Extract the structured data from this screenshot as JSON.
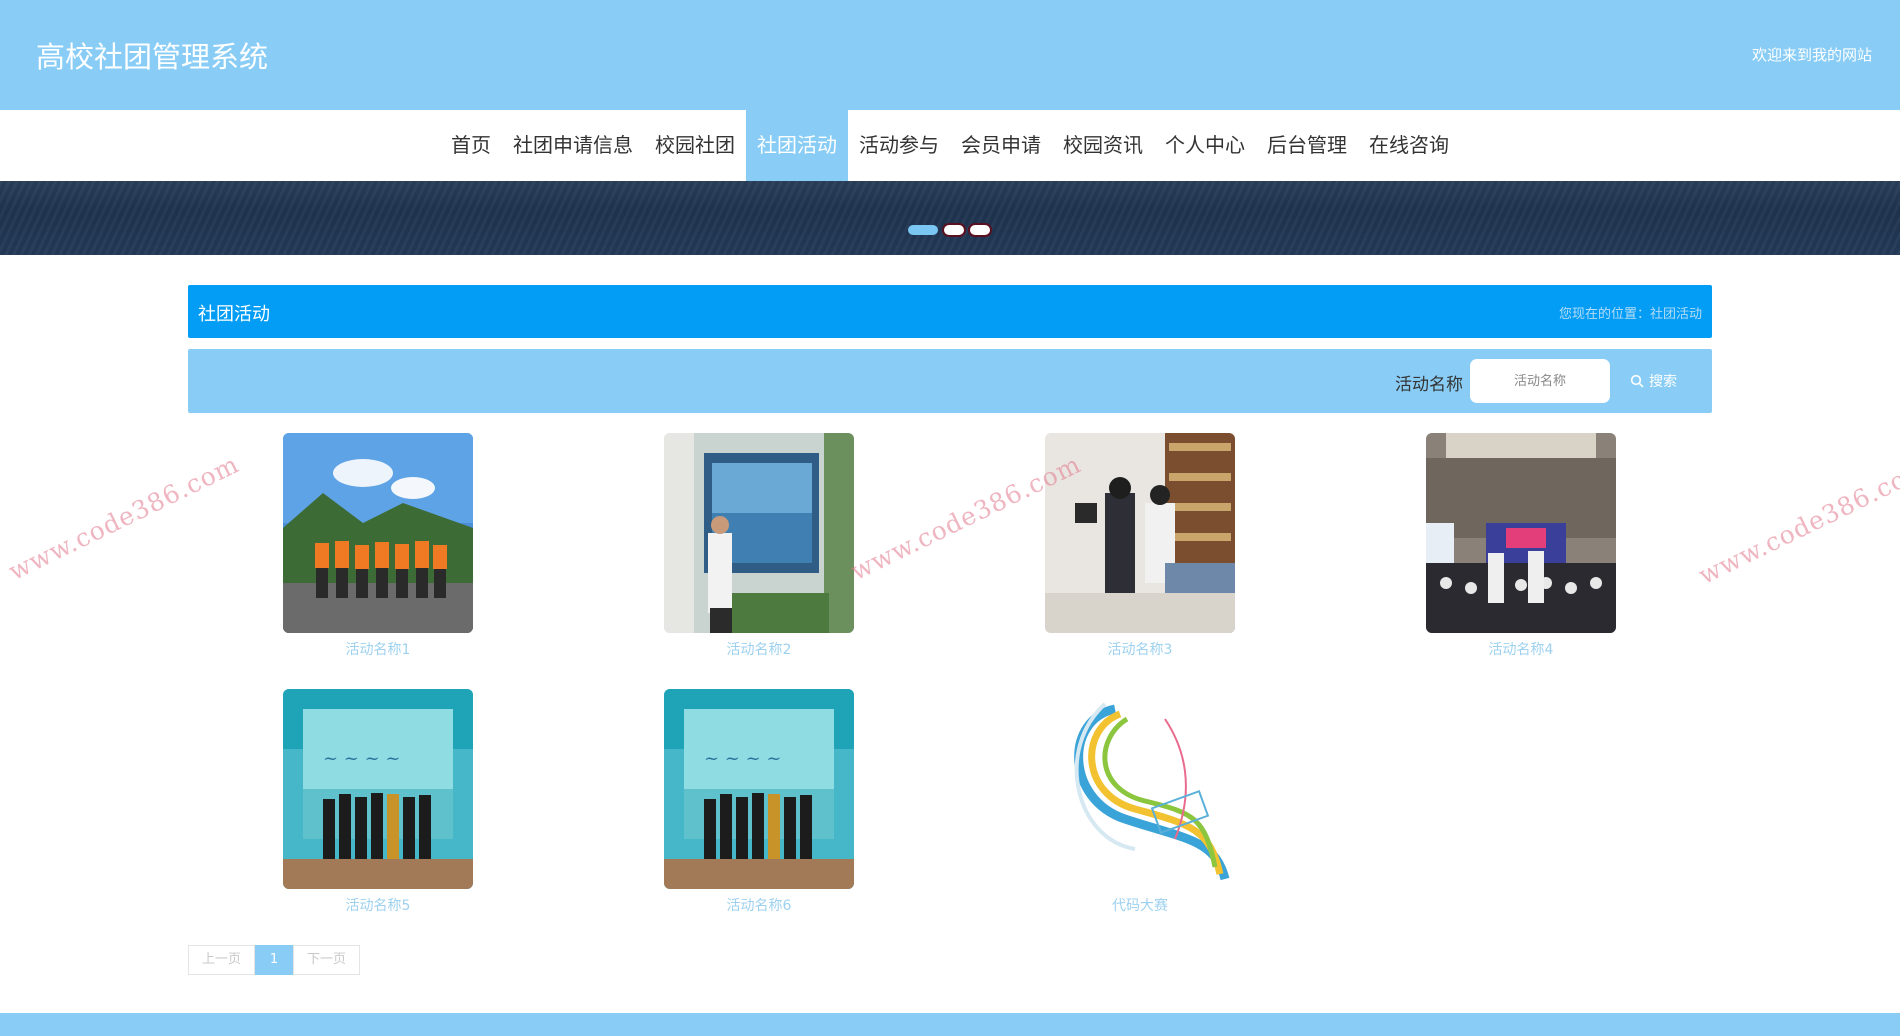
{
  "header": {
    "site_title": "高校社团管理系统",
    "welcome": "欢迎来到我的网站"
  },
  "nav": {
    "items": [
      "首页",
      "社团申请信息",
      "校园社团",
      "社团活动",
      "活动参与",
      "会员申请",
      "校园资讯",
      "个人中心",
      "后台管理",
      "在线咨询"
    ],
    "active": "社团活动"
  },
  "banner": {
    "slides": 3,
    "active_slide": 1
  },
  "breadcrumb": {
    "title": "社团活动",
    "location": "您现在的位置：社团活动"
  },
  "search": {
    "label": "活动名称",
    "placeholder": "活动名称",
    "button": "搜索"
  },
  "activities": [
    {
      "title": "活动名称1",
      "image": "group of people in orange life vests outdoors"
    },
    {
      "title": "活动名称2",
      "image": "person standing before a presentation board"
    },
    {
      "title": "活动名称3",
      "image": "people at a table in a library"
    },
    {
      "title": "活动名称4",
      "image": "conference hall with audience"
    },
    {
      "title": "活动名称5",
      "image": "group photo in front of a stage backdrop"
    },
    {
      "title": "活动名称6",
      "image": "group photo in front of a stage backdrop"
    },
    {
      "title": "代码大赛",
      "image": "abstract colourful swirl artwork"
    }
  ],
  "pagination": {
    "prev": "上一页",
    "current": "1",
    "next": "下一页"
  },
  "watermark": "www.code386.com",
  "colors": {
    "header_bg": "#89cdf6",
    "accent_blue": "#039df6",
    "link_light": "#9dd1ef"
  }
}
